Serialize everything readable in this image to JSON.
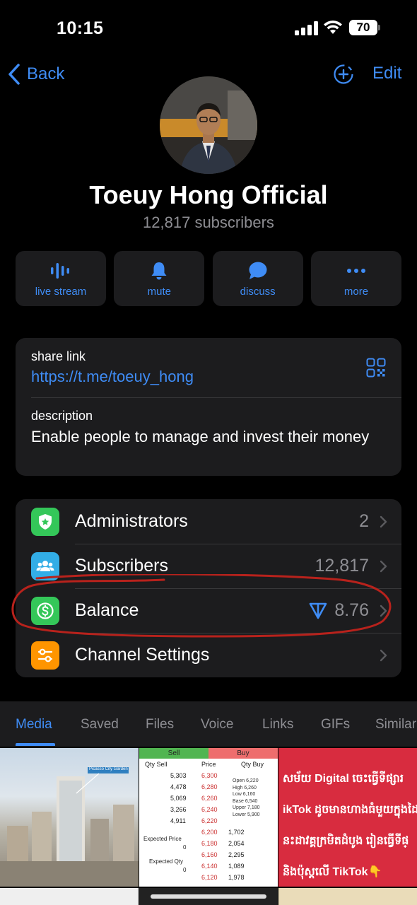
{
  "status_bar": {
    "time": "10:15",
    "battery": "70"
  },
  "nav": {
    "back_label": "Back",
    "edit_label": "Edit"
  },
  "profile": {
    "title": "Toeuy Hong Official",
    "subscribers": "12,817 subscribers"
  },
  "actions": [
    {
      "label": "live stream",
      "icon": "live-stream-icon"
    },
    {
      "label": "mute",
      "icon": "bell-icon"
    },
    {
      "label": "discuss",
      "icon": "chat-bubble-icon"
    },
    {
      "label": "more",
      "icon": "more-dots-icon"
    }
  ],
  "info": {
    "share_label": "share link",
    "share_url": "https://t.me/toeuy_hong",
    "description_label": "description",
    "description": "Enable people to manage and invest their money"
  },
  "settings": [
    {
      "label": "Administrators",
      "value": "2",
      "icon": "shield-star-icon",
      "color": "#34c759"
    },
    {
      "label": "Subscribers",
      "value": "12,817",
      "icon": "people-icon",
      "color": "#32ade6"
    },
    {
      "label": "Balance",
      "value": "8.76",
      "icon": "dollar-icon",
      "color": "#34c759"
    },
    {
      "label": "Channel Settings",
      "value": "",
      "icon": "sliders-icon",
      "color": "#ff9500"
    }
  ],
  "tabs": [
    "Media",
    "Saved",
    "Files",
    "Voice",
    "Links",
    "GIFs",
    "Similar"
  ],
  "media": {
    "tile1_caption": "Picasso City Garden",
    "tile2": {
      "sell": "Sell",
      "buy": "Buy",
      "col_qty_sell": "Qty Sell",
      "col_price": "Price",
      "col_qty_buy": "Qty Buy",
      "rows": [
        [
          "5,303",
          "6,300"
        ],
        [
          "4,478",
          "6,280"
        ],
        [
          "5,069",
          "6,260"
        ],
        [
          "3,266",
          "6,240"
        ],
        [
          "4,911",
          "6,220"
        ]
      ],
      "stats": [
        "Open 6,220",
        "High 6,260",
        "Low 6,160",
        "Base 6,540",
        "Upper 7,180",
        "Lower 5,900"
      ],
      "expected_price": "Expected Price",
      "expected_price_val": "0",
      "expected_qty": "Expected Qty",
      "expected_qty_val": "0",
      "buy_rows": [
        [
          "6,200",
          "1,702"
        ],
        [
          "6,180",
          "2,054"
        ],
        [
          "6,160",
          "2,295"
        ],
        [
          "6,140",
          "1,089"
        ],
        [
          "6,120",
          "1,978"
        ]
      ]
    },
    "tile3_lines": [
      "សម័យ Digital ចេះធ្វើទីផ្សារ",
      "ikTok ដូចមានហាងធំមួយក្នុងដៃ",
      "នះដាវគ្គក្រមិតដំបូង រៀនធ្វើទីផ្",
      "និងប៉ុស្តលើ TikTok👇"
    ]
  },
  "colors": {
    "accent": "#3f8cf5",
    "annotation": "#b8221c"
  }
}
